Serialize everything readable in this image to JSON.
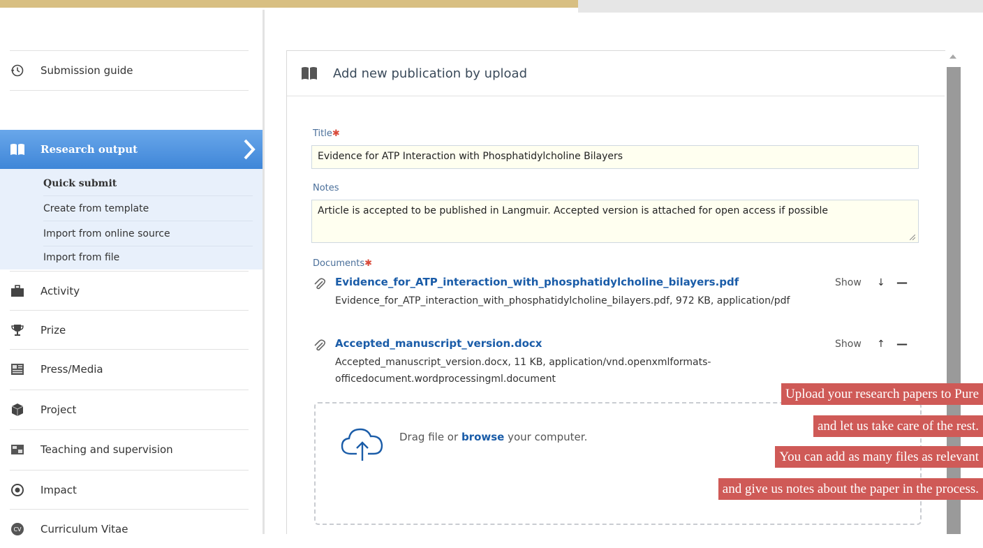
{
  "sidebar": {
    "submission_guide": "Submission guide",
    "research_output": "Research output",
    "subnav": [
      "Quick submit",
      "Create from template",
      "Import from online source",
      "Import from file"
    ],
    "items": [
      "Activity",
      "Prize",
      "Press/Media",
      "Project",
      "Teaching and supervision",
      "Impact",
      "Curriculum Vitae"
    ]
  },
  "panel": {
    "title": "Add new publication by upload",
    "title_label": "Title",
    "title_value": "Evidence for ATP Interaction with Phosphatidylcholine Bilayers",
    "notes_label": "Notes",
    "notes_value": "Article is accepted to be published in Langmuir. Accepted version is attached for open access if possible",
    "documents_label": "Documents",
    "required_mark": "✱",
    "documents": [
      {
        "name": "Evidence_for_ATP_interaction_with_phosphatidylcholine_bilayers.pdf",
        "desc": "Evidence_for_ATP_interaction_with_phosphatidylcholine_bilayers.pdf, 972 KB, application/pdf",
        "show": "Show",
        "arrow": "↓",
        "remove": "—"
      },
      {
        "name": "Accepted_manuscript_version.docx",
        "desc": "Accepted_manuscript_version.docx, 11 KB, application/vnd.openxmlformats-officedocument.wordprocessingml.document",
        "show": "Show",
        "arrow": "↑",
        "remove": "—"
      }
    ],
    "drop_text_before": "Drag file or ",
    "drop_browse": "browse",
    "drop_text_after": " your computer."
  },
  "promo": {
    "lines": [
      "Upload your research papers to Pure",
      "and let us take care of the rest.",
      "You can add as many files as relevant",
      "and give us notes about the paper in the process."
    ]
  },
  "colors": {
    "accent": "#3f86d8",
    "link": "#1a5ca8",
    "promo_bg": "#cf5a57",
    "top_bar": "#d8bf82"
  }
}
